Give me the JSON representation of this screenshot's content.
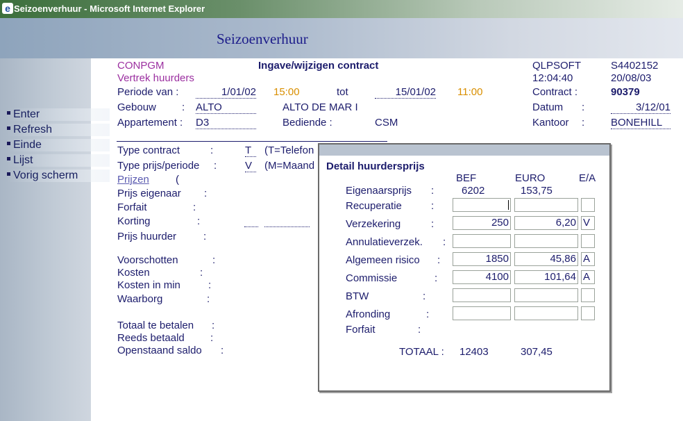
{
  "window": {
    "title": "Seizoenverhuur - Microsoft Internet Explorer"
  },
  "app": {
    "title": "Seizoenverhuur"
  },
  "menu": [
    {
      "label": "Enter"
    },
    {
      "label": "Refresh"
    },
    {
      "label": "Einde"
    },
    {
      "label": "Lijst"
    },
    {
      "label": "Vorig scherm"
    }
  ],
  "header": {
    "program": "CONPGM",
    "subtitle": "Vertrek huurders",
    "screen_title": "Ingave/wijzigen  contract",
    "company": "QLPSOFT",
    "code": "S4402152",
    "time": "12:04:40",
    "date": "20/08/03"
  },
  "form": {
    "periode_label": "Periode van  :",
    "periode_from": "1/01/02",
    "periode_from_time": "15:00",
    "tot_label": "tot",
    "periode_to": "15/01/02",
    "periode_to_time": "11:00",
    "contract_label": "Contract  :",
    "contract_value": "90379",
    "gebouw_label": "Gebouw",
    "gebouw_colon": ":",
    "gebouw_code": "ALTO",
    "gebouw_name": "ALTO DE MAR I",
    "datum_label": "Datum",
    "datum_colon": ":",
    "datum_value": "3/12/01",
    "appartement_label": "Appartement :",
    "appartement_value": "D3",
    "bediende_label": "Bediende :",
    "bediende_value": "CSM",
    "kantoor_label": "Kantoor",
    "kantoor_colon": ":",
    "kantoor_value": "BONEHILL",
    "type_contract_label": "Type contract",
    "type_contract_colon": ":",
    "type_contract_value": "T",
    "type_contract_desc": "(T=Telefon",
    "type_prijs_label": "Type prijs/periode",
    "type_prijs_colon": ":",
    "type_prijs_value": "V",
    "type_prijs_desc": "(M=Maand",
    "prijzen_link": "Prijzen",
    "prijzen_paren": "(",
    "rows": [
      {
        "label": "Prijs eigenaar",
        "colon": ":"
      },
      {
        "label": "Forfait",
        "colon": ":"
      },
      {
        "label": "Korting",
        "colon": ":"
      },
      {
        "label": "Prijs huurder",
        "colon": ":"
      },
      {
        "label": "Voorschotten",
        "colon": ":"
      },
      {
        "label": "Kosten",
        "colon": ":"
      },
      {
        "label": "Kosten in min",
        "colon": ":"
      },
      {
        "label": "Waarborg",
        "colon": ":"
      },
      {
        "label": "Totaal te betalen",
        "colon": ":"
      },
      {
        "label": "Reeds betaald",
        "colon": ":"
      },
      {
        "label": "Openstaand saldo",
        "colon": ":"
      }
    ]
  },
  "detail": {
    "title": "Detail huurdersprijs",
    "col_bef": "BEF",
    "col_euro": "EURO",
    "col_ea": "E/A",
    "eigenaarsprijs_label": "Eigenaarsprijs",
    "eigenaarsprijs_colon": ":",
    "eigenaarsprijs_bef": "6202",
    "eigenaarsprijs_euro": "153,75",
    "rows": [
      {
        "label": "Recuperatie",
        "colon": ":",
        "bef": "",
        "euro": "",
        "ea": ""
      },
      {
        "label": "Verzekering",
        "colon": ":",
        "bef": "250",
        "euro": "6,20",
        "ea": "V"
      },
      {
        "label": "Annulatieverzek.",
        "colon": ":",
        "bef": "",
        "euro": "",
        "ea": ""
      },
      {
        "label": "Algemeen risico",
        "colon": ":",
        "bef": "1850",
        "euro": "45,86",
        "ea": "A"
      },
      {
        "label": "Commissie",
        "colon": ":",
        "bef": "4100",
        "euro": "101,64",
        "ea": "A"
      },
      {
        "label": "BTW",
        "colon": ":",
        "bef": "",
        "euro": "",
        "ea": ""
      },
      {
        "label": "Afronding",
        "colon": ":",
        "bef": "",
        "euro": "",
        "ea": ""
      }
    ],
    "forfait_label": "Forfait",
    "forfait_colon": ":",
    "totaal_label": "TOTAAL :",
    "totaal_bef": "12403",
    "totaal_euro": "307,45"
  }
}
